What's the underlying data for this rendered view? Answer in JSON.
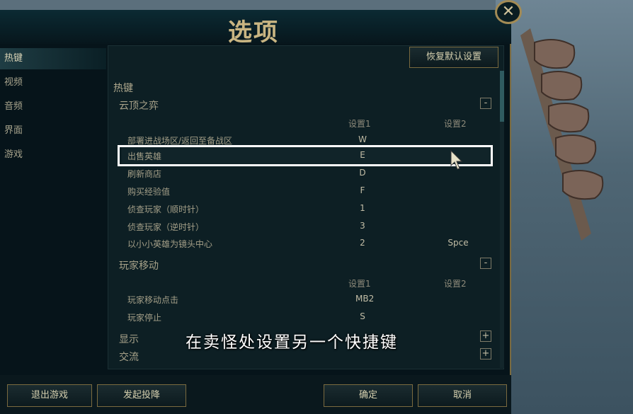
{
  "window_title": "选项",
  "close_glyph": "✕",
  "nav": [
    "热键",
    "视频",
    "音频",
    "界面",
    "游戏"
  ],
  "restore_label": "恢复默认设置",
  "section": "热键",
  "tft": {
    "title": "云顶之弈",
    "collapse_glyph": "-",
    "col1": "设置1",
    "col2": "设置2",
    "rows": [
      {
        "label": "部署进战场区/返回至备战区",
        "k1": "W",
        "k2": ""
      },
      {
        "label": "出售英雄",
        "k1": "E",
        "k2": ""
      },
      {
        "label": "刷新商店",
        "k1": "D",
        "k2": ""
      },
      {
        "label": "购买经验值",
        "k1": "F",
        "k2": ""
      },
      {
        "label": "侦查玩家（顺时针）",
        "k1": "1",
        "k2": ""
      },
      {
        "label": "侦查玩家（逆时针）",
        "k1": "3",
        "k2": ""
      },
      {
        "label": "以小小英雄为镜头中心",
        "k1": "2",
        "k2": "Spce"
      }
    ]
  },
  "move": {
    "title": "玩家移动",
    "collapse_glyph": "-",
    "col1": "设置1",
    "col2": "设置2",
    "rows": [
      {
        "label": "玩家移动点击",
        "k1": "MB2",
        "k2": ""
      },
      {
        "label": "玩家停止",
        "k1": "S",
        "k2": ""
      }
    ]
  },
  "display": {
    "title": "显示",
    "expand_glyph": "+"
  },
  "exchange": {
    "title": "交流",
    "expand_glyph": "+"
  },
  "video_subtitle": "在卖怪处设置另一个快捷键",
  "buttons": {
    "exit": "退出游戏",
    "surrender": "发起投降",
    "ok": "确定",
    "cancel": "取消"
  }
}
